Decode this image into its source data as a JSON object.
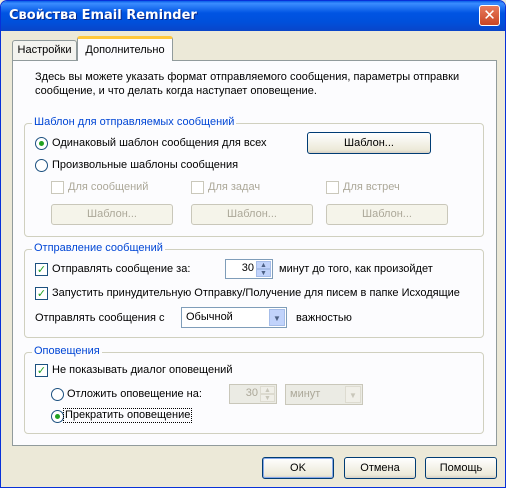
{
  "window": {
    "title": "Свойства Email Reminder",
    "close_glyph": "✕"
  },
  "tabs": [
    {
      "label": "Настройки",
      "active": false
    },
    {
      "label": "Дополнительно",
      "active": true
    }
  ],
  "intro": "Здесь вы можете указать формат отправляемого сообщения, параметры отправки сообщение, и что делать когда наступает оповещение.",
  "template_group": {
    "title": "Шаблон для отправляемых сообщений",
    "radio_same": "Одинаковый шаблон сообщения для всех",
    "radio_same_checked": true,
    "template_button": "Шаблон...",
    "radio_custom": "Произвольные шаблоны сообщения",
    "radio_custom_checked": false,
    "checks": [
      {
        "label": "Для сообщений",
        "checked": false,
        "button": "Шаблон..."
      },
      {
        "label": "Для задач",
        "checked": false,
        "button": "Шаблон..."
      },
      {
        "label": "Для встреч",
        "checked": false,
        "button": "Шаблон..."
      }
    ]
  },
  "send_group": {
    "title": "Отправление сообщений",
    "send_before_label": "Отправлять сообщение за:",
    "send_before_checked": true,
    "minutes_value": "30",
    "minutes_suffix": "минут до того, как произойдет",
    "force_send_label": "Запустить принудительную Отправку/Получение для писем в папке Исходящие",
    "force_send_checked": true,
    "importance_label": "Отправлять сообщения с",
    "importance_value": "Обычной",
    "importance_suffix": "важностью"
  },
  "alerts_group": {
    "title": "Оповещения",
    "hide_dialog_label": "Не показывать диалог оповещений",
    "hide_dialog_checked": true,
    "postpone_label": "Отложить оповещение на:",
    "postpone_checked": false,
    "postpone_value": "30",
    "postpone_unit": "минут",
    "stop_label": "Прекратить оповещение",
    "stop_checked": true
  },
  "footer": {
    "ok": "OK",
    "cancel": "Отмена",
    "help": "Помощь"
  },
  "icons": {
    "arrow_up": "▲",
    "arrow_down": "▼",
    "check": "✓"
  },
  "colors": {
    "title_bar": "#0054e3",
    "group_title": "#0046d5",
    "dialog_bg": "#ece9d8"
  }
}
